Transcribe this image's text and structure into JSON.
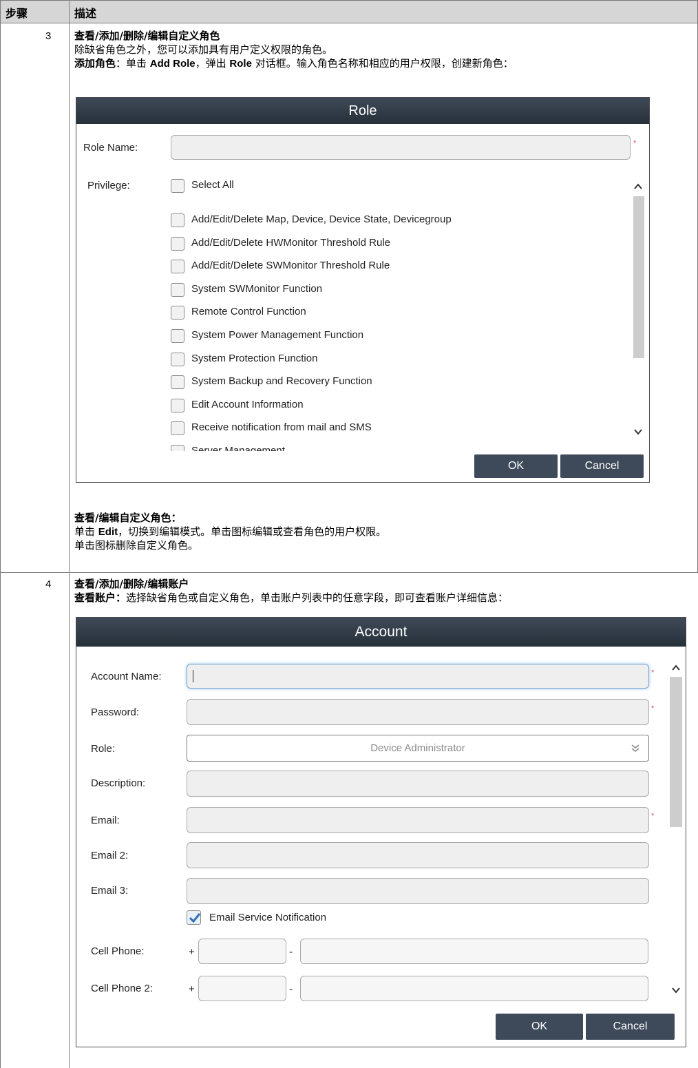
{
  "table": {
    "header_step": "步骤",
    "header_desc": "描述"
  },
  "step3": {
    "num": "3",
    "title": "查看/添加/删除/编辑自定义角色",
    "line1": "除缺省角色之外，您可以添加具有用户定义权限的角色。",
    "add_bold": "添加角色",
    "add_p1": "：单击 ",
    "add_btn": "Add Role",
    "add_p2": "，弹出 ",
    "add_role": "Role",
    "add_p3": " 对话框。输入角色名称和相应的用户权限，创建新角色：",
    "view_edit_title": "查看/编辑自定义角色：",
    "edit_p1": "单击 ",
    "edit_word": "Edit",
    "edit_p2": "，切换到编辑模式。单击图标编辑或查看角色的用户权限。",
    "delete_line": "单击图标删除自定义角色。"
  },
  "role_dialog": {
    "title": "Role",
    "role_name_label": "Role Name:",
    "privilege_label": "Privilege:",
    "select_all": "Select All",
    "privileges": [
      "Add/Edit/Delete Map, Device, Device State, Devicegroup",
      "Add/Edit/Delete HWMonitor Threshold Rule",
      "Add/Edit/Delete SWMonitor Threshold Rule",
      "System SWMonitor Function",
      "Remote Control Function",
      "System Power Management Function",
      "System Protection Function",
      "System Backup and Recovery Function",
      "Edit Account Information",
      "Receive notification from mail and SMS",
      "Server Management"
    ],
    "ok": "OK",
    "cancel": "Cancel",
    "required_mark": "*"
  },
  "step4": {
    "num": "4",
    "title": "查看/添加/删除/编辑账户",
    "view_bold": "查看账户：",
    "view_text": "选择缺省角色或自定义角色，单击账户列表中的任意字段，即可查看账户详细信息："
  },
  "account_dialog": {
    "title": "Account",
    "account_name_label": "Account Name:",
    "password_label": "Password:",
    "role_label": "Role:",
    "role_value": "Device Administrator",
    "description_label": "Description:",
    "email_label": "Email:",
    "email2_label": "Email 2:",
    "email3_label": "Email 3:",
    "email_service": "Email Service Notification",
    "cell_phone_label": "Cell Phone:",
    "cell_phone2_label": "Cell Phone 2:",
    "plus": "+",
    "dash": "-",
    "ok": "OK",
    "cancel": "Cancel",
    "required_mark": "*"
  }
}
